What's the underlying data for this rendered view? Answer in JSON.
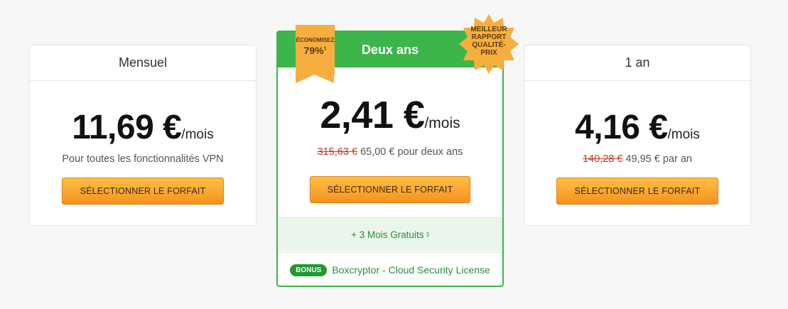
{
  "plans": {
    "monthly": {
      "title": "Mensuel",
      "price": "11,69 €",
      "unit": "/mois",
      "description": "Pour toutes les fonctionnalités VPN",
      "button": "SÉLECTIONNER LE FORFAIT"
    },
    "two_years": {
      "title": "Deux ans",
      "price": "2,41 €",
      "unit": "/mois",
      "old_price": "315,63 €",
      "billing": "65,00 € pour deux ans",
      "button": "SÉLECTIONNER LE FORFAIT",
      "ribbon_label": "ÉCONOMISEZ",
      "ribbon_value": "79%",
      "ribbon_sup": "1",
      "burst_lines": [
        "MEILLEUR",
        "RAPPORT",
        "QUALITÉ-",
        "PRIX"
      ],
      "promo_text": "+ 3 Mois Gratuits",
      "promo_sup": "3",
      "bonus_badge": "BONUS",
      "bonus_text": "Boxcryptor - Cloud Security License"
    },
    "one_year": {
      "title": "1 an",
      "price": "4,16 €",
      "unit": "/mois",
      "old_price": "140,28 €",
      "billing": "49,95 € par an",
      "button": "SÉLECTIONNER LE FORFAIT"
    }
  },
  "colors": {
    "accent_green": "#3cb64a",
    "button_orange": "#f6921e",
    "strike_red": "#c0392b",
    "badge_orange": "#f6ae3f"
  }
}
